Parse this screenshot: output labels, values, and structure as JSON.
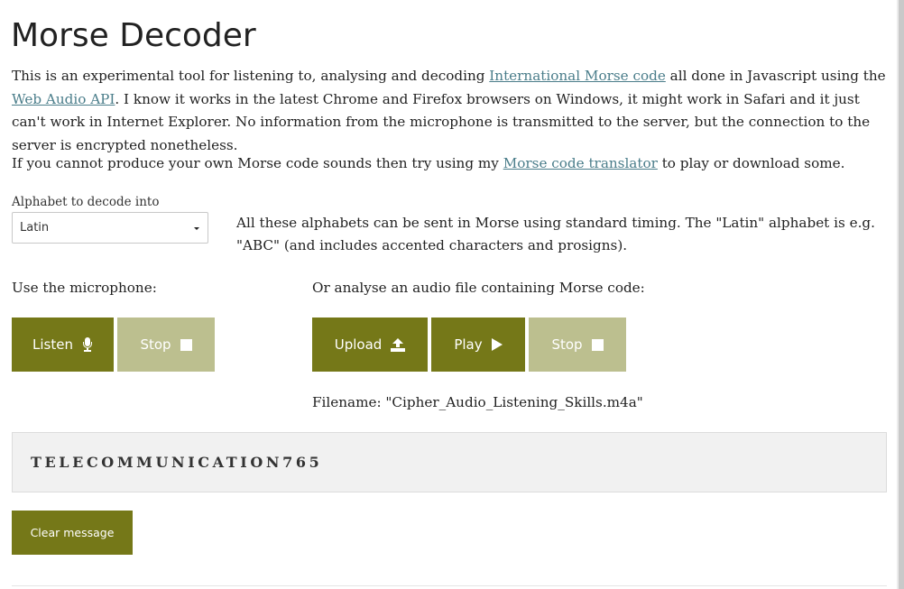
{
  "page": {
    "title": "Morse Decoder"
  },
  "intro": {
    "text_1": "This is an experimental tool for listening to, analysing and decoding ",
    "link_morse": "International Morse code",
    "text_2": " all done in Javascript using the ",
    "link_webaudio": "Web Audio API",
    "text_3": ". I know it works in the latest Chrome and Firefox browsers on Windows, it might work in Safari and it just can't work in Internet Explorer. No information from the microphone is transmitted to the server, but the connection to the server is encrypted nonetheless."
  },
  "intro2": {
    "text_1": "If you cannot produce your own Morse code sounds then try using my ",
    "link_translator": "Morse code translator",
    "text_2": " to play or download some."
  },
  "alphabet": {
    "label": "Alphabet to decode into",
    "selected": "Latin",
    "note": "All these alphabets can be sent in Morse using standard timing. The \"Latin\" alphabet is e.g. \"ABC\" (and includes accented characters and prosigns)."
  },
  "microphone": {
    "label": "Use the microphone:",
    "listen_label": "Listen",
    "stop_label": "Stop"
  },
  "file": {
    "label": "Or analyse an audio file containing Morse code:",
    "upload_label": "Upload",
    "play_label": "Play",
    "stop_label": "Stop",
    "filename": "Filename: \"Cipher_Audio_Listening_Skills.m4a\""
  },
  "output": {
    "message": "TELECOMMUNICATION765"
  },
  "actions": {
    "clear_label": "Clear message"
  },
  "colors": {
    "button": "#757818",
    "button_disabled": "#bcbf8f",
    "link": "#4a7d8a",
    "output_bg": "#f1f1f1"
  },
  "icons": {
    "listen": "microphone-icon",
    "stop": "stop-square-icon",
    "upload": "upload-icon",
    "play": "play-icon",
    "select": "caret-down-icon"
  }
}
